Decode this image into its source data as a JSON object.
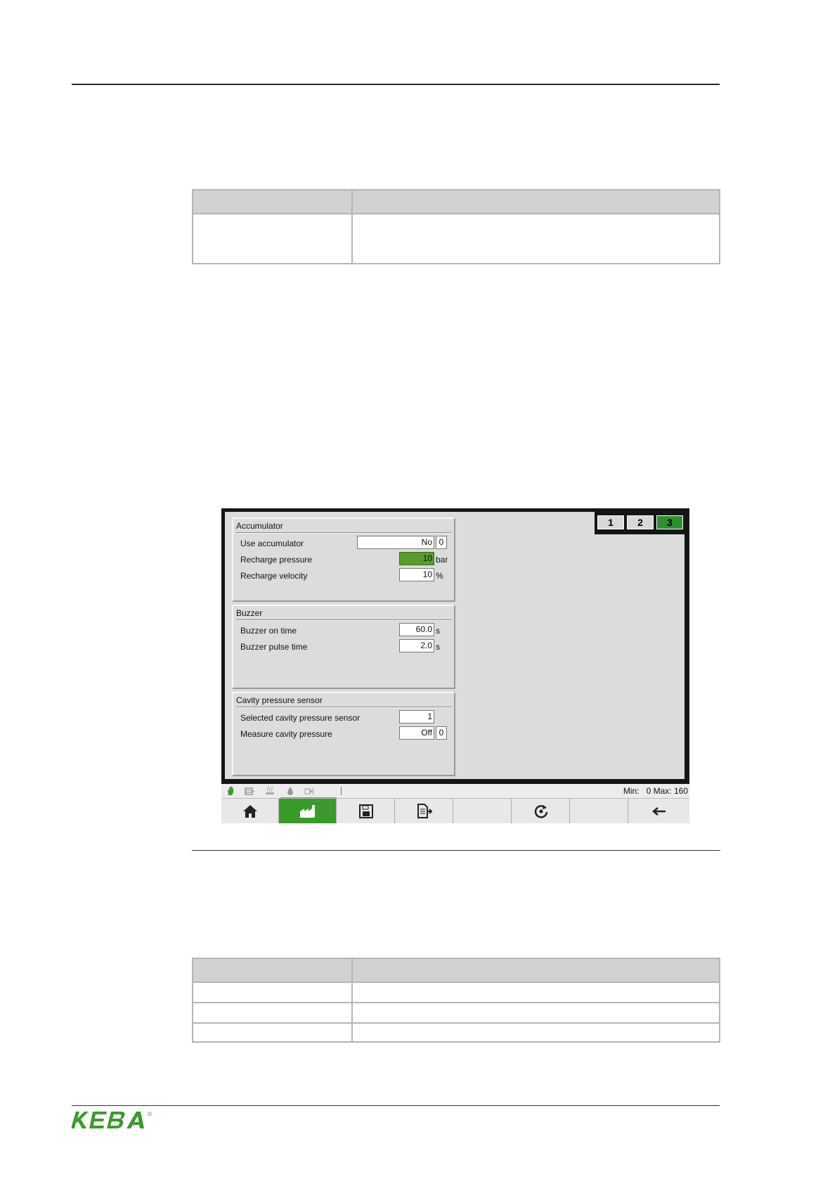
{
  "tables": {
    "top": {
      "header": [
        "",
        ""
      ],
      "rows": [
        [
          "",
          ""
        ]
      ]
    },
    "bottom": {
      "header": [
        "",
        ""
      ],
      "rows": [
        [
          "",
          ""
        ],
        [
          "",
          ""
        ],
        [
          "",
          ""
        ]
      ]
    }
  },
  "hmi": {
    "page_tabs": [
      "1",
      "2",
      "3"
    ],
    "active_page": "3",
    "groups": {
      "accumulator": {
        "title": "Accumulator",
        "rows": [
          {
            "label": "Use accumulator",
            "value": "No",
            "index": "0"
          },
          {
            "label": "Recharge pressure",
            "value": "10",
            "unit": "bar"
          },
          {
            "label": "Recharge velocity",
            "value": "10",
            "unit": "%"
          }
        ]
      },
      "buzzer": {
        "title": "Buzzer",
        "rows": [
          {
            "label": "Buzzer on time",
            "value": "60.0",
            "unit": "s"
          },
          {
            "label": "Buzzer pulse time",
            "value": "2.0",
            "unit": "s"
          }
        ]
      },
      "cavity": {
        "title": "Cavity pressure sensor",
        "rows": [
          {
            "label": "Selected cavity pressure sensor",
            "value": "1"
          },
          {
            "label": "Measure cavity pressure",
            "value": "Off",
            "index": "0"
          }
        ]
      }
    },
    "status": {
      "min_label": "Min:",
      "min_value": "0",
      "max_label": "Max:",
      "max_value": "160",
      "icons": [
        "hand-icon",
        "mold-icon",
        "heating-icon",
        "oil-drop-icon",
        "injection-icon"
      ]
    },
    "nav": {
      "buttons": [
        "home-icon",
        "factory-icon",
        "save-icon",
        "document-export-icon",
        "blank",
        "cycle-icon",
        "blank",
        "back-arrow-icon"
      ],
      "active": "factory-icon",
      "accent": "#3a9b2b"
    }
  },
  "footer": {
    "logo": "KEBA",
    "logo_color": "#3c9a2e"
  }
}
